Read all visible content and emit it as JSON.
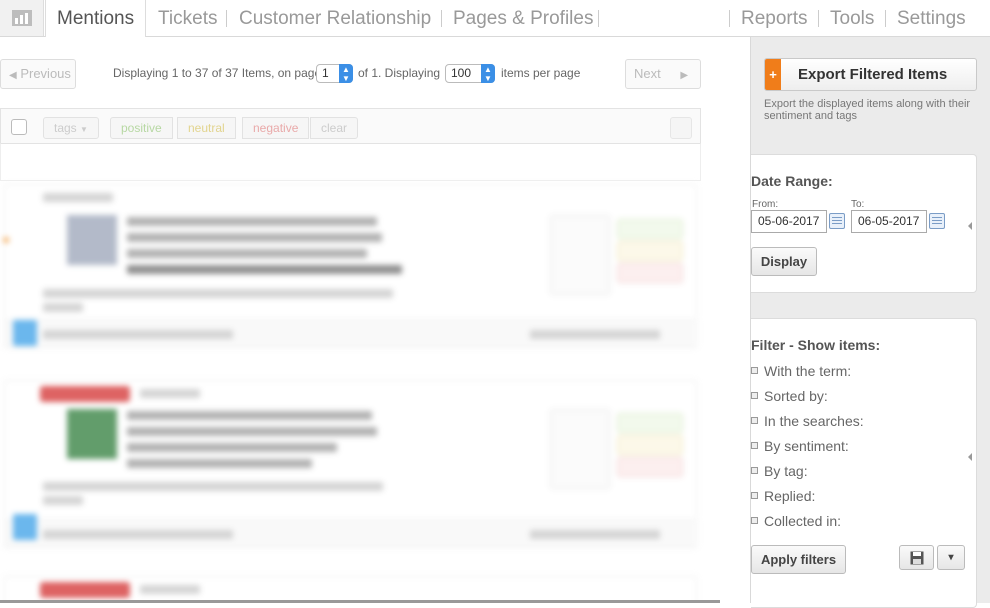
{
  "nav": {
    "tabs": [
      {
        "label": "Mentions",
        "active": true
      },
      {
        "label": "Tickets"
      },
      {
        "label": "Customer Relationship"
      },
      {
        "label": "Pages & Profiles"
      }
    ],
    "right_tabs": [
      {
        "label": "Reports"
      },
      {
        "label": "Tools"
      },
      {
        "label": "Settings"
      }
    ]
  },
  "pager": {
    "prev": "Previous",
    "next": "Next",
    "info_prefix": "Displaying 1 to 37 of 37 Items, on page",
    "page": "1",
    "info_mid": "of 1. Displaying",
    "per_page": "100",
    "info_suffix": "items per page"
  },
  "toolbar": {
    "tags": "tags",
    "positive": "positive",
    "neutral": "neutral",
    "negative": "negative",
    "clear": "clear"
  },
  "sidebar": {
    "export_button": "Export Filtered Items",
    "export_plus": "+",
    "export_desc": "Export the displayed items along with their sentiment and tags",
    "date_range": {
      "title": "Date Range:",
      "from_label": "From:",
      "from_value": "05-06-2017",
      "to_label": "To:",
      "to_value": "06-05-2017",
      "display_button": "Display"
    },
    "filter": {
      "title": "Filter - Show items:",
      "items": [
        "With the term:",
        "Sorted by:",
        "In the searches:",
        "By sentiment:",
        "By tag:",
        "Replied:",
        "Collected in:"
      ],
      "apply_button": "Apply filters",
      "dropdown_caret": "▾"
    }
  },
  "colors": {
    "accent_orange": "#f07d1a",
    "select_blue": "#3b8fe6",
    "positive": "#8dc26f",
    "neutral": "#e0c85a",
    "negative": "#e07b7b"
  }
}
